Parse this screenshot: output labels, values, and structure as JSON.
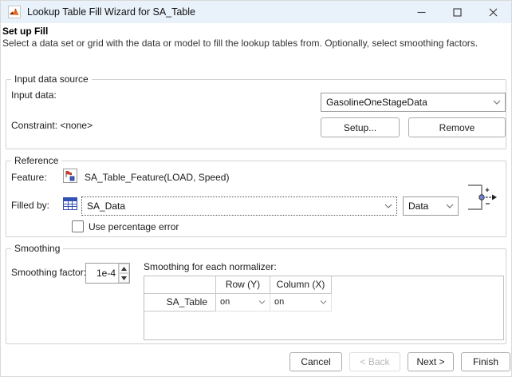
{
  "window": {
    "title": "Lookup Table Fill Wizard for SA_Table"
  },
  "header": {
    "title": "Set up Fill",
    "description": "Select a data set or grid with the data or model to fill the lookup tables from. Optionally, select smoothing factors."
  },
  "input_data_source": {
    "group_label": "Input data source",
    "input_data_label": "Input data:",
    "input_data_value": "GasolineOneStageData",
    "constraint_label": "Constraint: <none>",
    "setup_button": "Setup...",
    "remove_button": "Remove"
  },
  "reference": {
    "group_label": "Reference",
    "feature_label": "Feature:",
    "feature_value": "SA_Table_Feature(LOAD, Speed)",
    "filled_by_label": "Filled by:",
    "filled_by_value": "SA_Data",
    "fill_type_value": "Data",
    "use_percentage_error_label": "Use percentage error",
    "use_percentage_error_checked": false
  },
  "smoothing": {
    "group_label": "Smoothing",
    "factor_label": "Smoothing factor:",
    "factor_value": "1e-4",
    "normalizer_label": "Smoothing for each normalizer:",
    "table": {
      "columns": [
        "",
        "Row (Y)",
        "Column (X)"
      ],
      "rows": [
        {
          "name": "SA_Table",
          "row_y": "on",
          "column_x": "on"
        }
      ]
    }
  },
  "footer": {
    "cancel": "Cancel",
    "back": "< Back",
    "next": "Next >",
    "finish": "Finish"
  },
  "colors": {
    "titlebar_bg": "#e9f1fa",
    "matlab_orange": "#e8661a",
    "table_icon_blue": "#3350b5",
    "feature_red": "#c23a2b",
    "feature_blue": "#3f5fbf"
  }
}
